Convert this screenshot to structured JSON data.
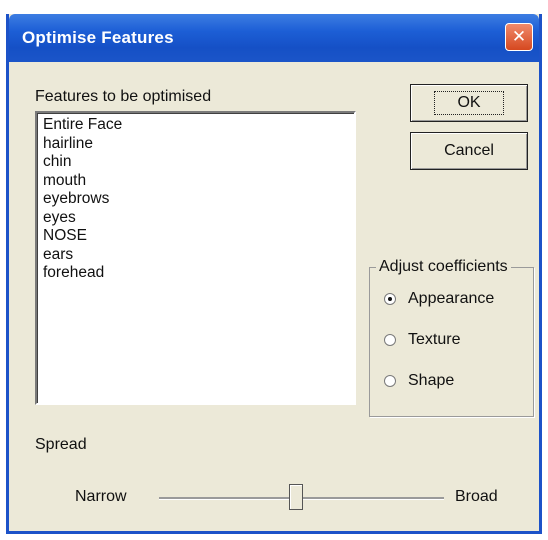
{
  "window": {
    "title": "Optimise Features",
    "close_glyph": "✕"
  },
  "features": {
    "label": "Features to be optimised",
    "items": [
      "Entire Face",
      "hairline",
      "chin",
      "mouth",
      "eyebrows",
      "eyes",
      "NOSE",
      "ears",
      "forehead"
    ]
  },
  "buttons": {
    "ok": "OK",
    "cancel": "Cancel"
  },
  "coefficients": {
    "label": "Adjust coefficients",
    "options": [
      {
        "label": "Appearance",
        "selected": true
      },
      {
        "label": "Texture",
        "selected": false
      },
      {
        "label": "Shape",
        "selected": false
      }
    ]
  },
  "spread": {
    "label": "Spread",
    "min_label": "Narrow",
    "max_label": "Broad",
    "value": 0.48
  }
}
